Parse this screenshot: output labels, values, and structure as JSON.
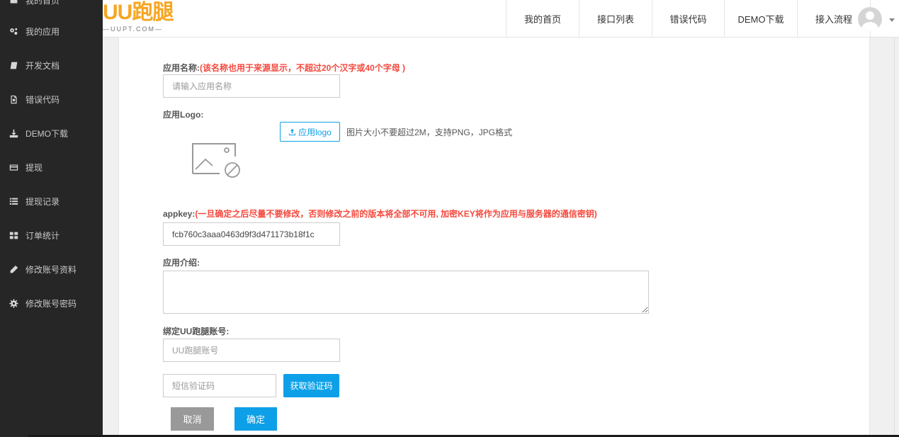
{
  "sidebar": {
    "items": [
      {
        "label": "我的首页",
        "icon": "home-icon"
      },
      {
        "label": "我的应用",
        "icon": "gears-icon"
      },
      {
        "label": "开发文档",
        "icon": "book-icon"
      },
      {
        "label": "错误代码",
        "icon": "file-code-icon"
      },
      {
        "label": "DEMO下载",
        "icon": "download-icon"
      },
      {
        "label": "提现",
        "icon": "card-icon"
      },
      {
        "label": "提现记录",
        "icon": "list-icon"
      },
      {
        "label": "订单统计",
        "icon": "grid-icon"
      },
      {
        "label": "修改账号资料",
        "icon": "pencil-icon"
      },
      {
        "label": "修改账号密码",
        "icon": "gear-icon"
      }
    ]
  },
  "header": {
    "logo_text": "UU跑腿",
    "logo_sub": "—UUPT.COM—",
    "nav": [
      "我的首页",
      "接口列表",
      "错误代码",
      "DEMO下载",
      "接入流程"
    ]
  },
  "form": {
    "app_name_label": "应用名称:",
    "app_name_hint": "(该名称也用于来源显示，不超过20个汉字或40个字母 )",
    "app_name_placeholder": "请输入应用名称",
    "logo_label": "应用Logo:",
    "upload_label": "应用logo",
    "upload_tip": "图片大小不要超过2M，支持PNG，JPG格式",
    "appkey_label": "appkey:",
    "appkey_hint": "(一旦确定之后尽量不要修改，否则修改之前的版本将全部不可用, 加密KEY将作为应用与服务器的通信密钥)",
    "appkey_value": "fcb760c3aaa0463d9f3d471173b18f1c",
    "intro_label": "应用介绍:",
    "bind_label": "绑定UU跑腿账号:",
    "account_placeholder": "UU跑腿账号",
    "sms_placeholder": "短信验证码",
    "get_code_label": "获取验证码",
    "cancel_label": "取消",
    "confirm_label": "确定"
  },
  "colors": {
    "accent": "#0da0e8",
    "hint": "#f5493e",
    "sidebar_bg": "#262626",
    "logo": "#f5a623"
  }
}
